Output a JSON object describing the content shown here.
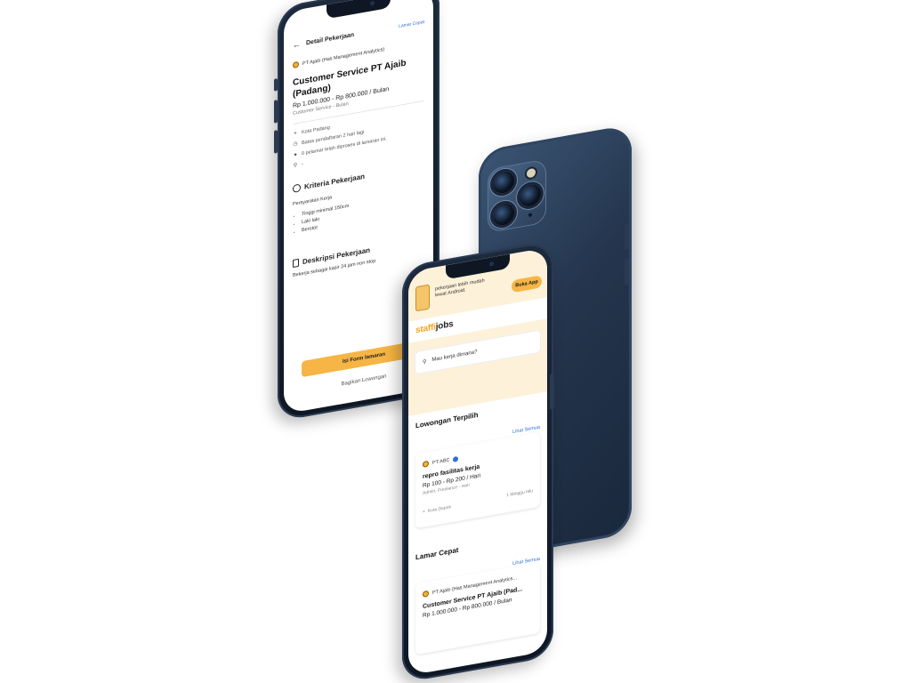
{
  "detail_screen": {
    "header_title": "Detail Pekerjaan",
    "header_link": "Lamar Cepat",
    "company": "PT Ajaib (Has Management Analytics)",
    "job_title": "Customer Service PT Ajaib (Padang)",
    "salary": "Rp 1.000.000 - Rp 800.000 / Bulan",
    "meta": "Customer Service - Bulan",
    "info": [
      {
        "icon": "location-icon",
        "text": "Kota Padang"
      },
      {
        "icon": "clock-icon",
        "text": "Batas pendaftaran 2 hari lagi"
      },
      {
        "icon": "person-icon",
        "text": "0 pelamar telah diproses di lamaran ini."
      },
      {
        "icon": "search-icon",
        "text": "-"
      }
    ],
    "criteria_title": "Kriteria Pekerjaan",
    "requirements_label": "Persyaratan Kerja",
    "requirements": [
      "Tinggi minimal 150cm",
      "Laki laki",
      "Berotot"
    ],
    "description_title": "Deskripsi Pekerjaan",
    "description_text": "Bekerja sebagai kasir 24 jam non stop",
    "apply_button": "Isi Form lamaran",
    "share_button": "Bagikan Lowongan"
  },
  "home_screen": {
    "promo_text": "pekerjaan lebih mudah lewat Android.",
    "open_app_button": "Buka App",
    "brand_prefix": "staffi",
    "brand_suffix": "jobs",
    "search_placeholder": "Mau kerja dimana?",
    "featured_title": "Lowongan Terpilih",
    "featured_see_all": "Lihat Semua",
    "featured_card": {
      "company": "PT ABC",
      "title": "repro fasilitas kerja",
      "salary": "Rp 100 - Rp 200 / Hari",
      "meta": "Admin, Freelance - Hari",
      "location": "Kota Depok",
      "time": "1 Minggu lalu"
    },
    "quick_title": "Lamar Cepat",
    "quick_see_all": "Lihat Semua",
    "quick_card": {
      "company": "PT Ajaib (Has Management Analytics...",
      "title": "Customer Service PT Ajaib (Pad...",
      "salary": "Rp 1.000.000 - Rp 800.000 / Bulan"
    }
  },
  "colors": {
    "accent": "#f6b544",
    "promo_bg": "#fdf1d9",
    "link": "#2b6fd6",
    "phone_body": "#24354d"
  }
}
